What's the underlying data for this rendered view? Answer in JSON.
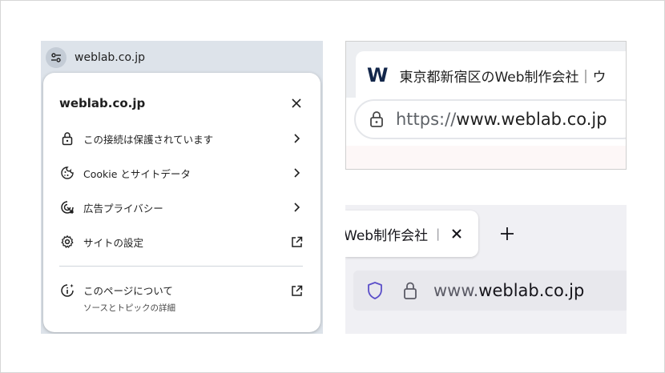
{
  "left_panel": {
    "chip_label": "weblab.co.jp",
    "popup": {
      "title": "weblab.co.jp",
      "items": [
        {
          "label": "この接続は保護されています",
          "icon": "lock-icon",
          "trail": "chevron-right-icon"
        },
        {
          "label": "Cookie とサイトデータ",
          "icon": "cookie-icon",
          "trail": "chevron-right-icon"
        },
        {
          "label": "広告プライバシー",
          "icon": "ad-privacy-icon",
          "trail": "chevron-right-icon"
        },
        {
          "label": "サイトの設定",
          "icon": "gear-icon",
          "trail": "external-link-icon"
        }
      ],
      "about": {
        "title": "このページについて",
        "subtitle": "ソースとトピックの詳細"
      }
    }
  },
  "top_right": {
    "favicon_letter": "W",
    "tab_title": "東京都新宿区のWeb制作会社｜ウ",
    "url_scheme": "https://",
    "url_host": "www.weblab.co.jp"
  },
  "bottom_right": {
    "tab_title": "Web制作会社",
    "tab_separator": "|",
    "url_subdomain": "www.",
    "url_domain": "weblab.co.jp"
  },
  "colors": {
    "chrome_header_bg": "#dde3ea",
    "favicon": "#12264a",
    "firefox_shield": "#5b4fc9"
  }
}
